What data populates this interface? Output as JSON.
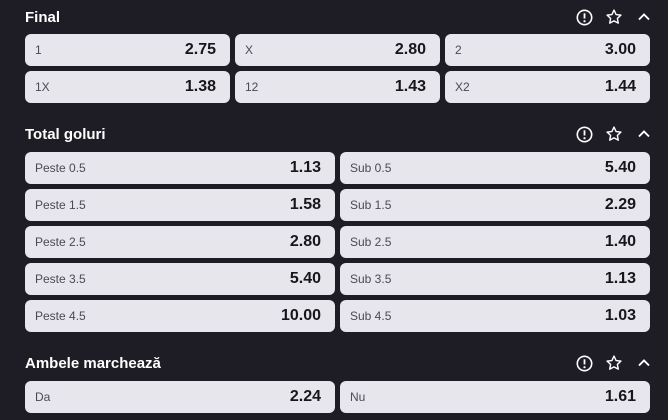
{
  "sections": [
    {
      "title": "Final",
      "rows": [
        [
          {
            "label": "1",
            "odd": "2.75"
          },
          {
            "label": "X",
            "odd": "2.80"
          },
          {
            "label": "2",
            "odd": "3.00"
          }
        ],
        [
          {
            "label": "1X",
            "odd": "1.38"
          },
          {
            "label": "12",
            "odd": "1.43"
          },
          {
            "label": "X2",
            "odd": "1.44"
          }
        ]
      ]
    },
    {
      "title": "Total goluri",
      "rows": [
        [
          {
            "label": "Peste 0.5",
            "odd": "1.13"
          },
          {
            "label": "Sub 0.5",
            "odd": "5.40"
          }
        ],
        [
          {
            "label": "Peste 1.5",
            "odd": "1.58"
          },
          {
            "label": "Sub 1.5",
            "odd": "2.29"
          }
        ],
        [
          {
            "label": "Peste 2.5",
            "odd": "2.80"
          },
          {
            "label": "Sub 2.5",
            "odd": "1.40"
          }
        ],
        [
          {
            "label": "Peste 3.5",
            "odd": "5.40"
          },
          {
            "label": "Sub 3.5",
            "odd": "1.13"
          }
        ],
        [
          {
            "label": "Peste 4.5",
            "odd": "10.00"
          },
          {
            "label": "Sub 4.5",
            "odd": "1.03"
          }
        ]
      ]
    },
    {
      "title": "Ambele marchează",
      "rows": [
        [
          {
            "label": "Da",
            "odd": "2.24"
          },
          {
            "label": "Nu",
            "odd": "1.61"
          }
        ]
      ]
    }
  ],
  "icons": {
    "info": "info-icon",
    "favorite": "star-icon",
    "collapse": "chevron-up-icon"
  },
  "colors": {
    "background": "#1e1d26",
    "button": "#e6e6ec",
    "text_dark": "#16161d"
  }
}
